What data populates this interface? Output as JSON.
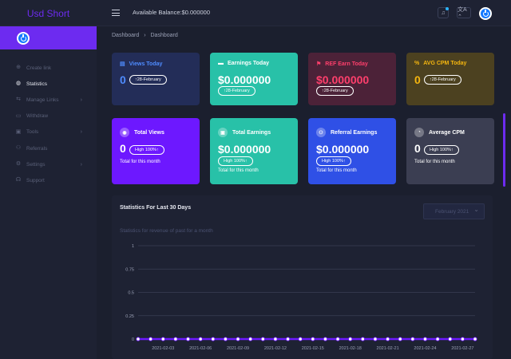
{
  "brand": {
    "name": "Usd Short"
  },
  "topbar": {
    "balance": "Available Balance:$0.000000",
    "bell_icon": "bell-icon",
    "lang_icon": "translate-icon",
    "lang_glyph": "文A ⌃"
  },
  "sidebar": {
    "items": [
      {
        "label": "Create link",
        "icon": "⊕",
        "active": false
      },
      {
        "label": "Statistics",
        "icon": "◍",
        "active": true
      },
      {
        "label": "Manage Links",
        "icon": "⇆",
        "active": false,
        "chevron": "›"
      },
      {
        "label": "Withdraw",
        "icon": "▭",
        "active": false
      },
      {
        "label": "Tools",
        "icon": "▣",
        "active": false,
        "chevron": "›"
      },
      {
        "label": "Referrals",
        "icon": "⚇",
        "active": false
      },
      {
        "label": "Settings",
        "icon": "⚙",
        "active": false,
        "chevron": "›"
      },
      {
        "label": "Support",
        "icon": "☊",
        "active": false
      }
    ]
  },
  "breadcrumb": {
    "root": "Dashboard",
    "separator": "›",
    "current": "Dashboard"
  },
  "cards_row1": [
    {
      "label": "Views Today",
      "value": "0",
      "badge": "↑28-February",
      "bg": "#232d58",
      "label_color": "#4f8cff",
      "symbol": "▤"
    },
    {
      "label": "Earnings Today",
      "value": "$0.000000",
      "badge": "↑28-February",
      "bg": "#28c1a8",
      "label_color": "#ffffff",
      "symbol": "▬"
    },
    {
      "label": "REF Earn Today",
      "value": "$0.000000",
      "badge": "↑28-February",
      "bg": "#4c2238",
      "label_color": "#ff3f6c",
      "value_color": "#ff3f6c",
      "symbol": "⚑"
    },
    {
      "label": "AVG CPM Today",
      "value": "0",
      "badge": "↑28-February",
      "bg": "#4c4120",
      "label_color": "#f5b60f",
      "value_color": "#f5b60f",
      "symbol": "%"
    }
  ],
  "cards_row2": [
    {
      "label": "Total Views",
      "value": "0",
      "badge": "High  100%↑",
      "sub": "Total for this month",
      "bg": "#6d18ff",
      "symbol": "◉"
    },
    {
      "label": "Total Earnings",
      "value": "$0.000000",
      "badge": "High  100%↑",
      "sub": "Total for this month",
      "bg": "#28c1a8",
      "symbol": "▣"
    },
    {
      "label": "Referral Earnings",
      "value": "$0.000000",
      "badge": "High  100%↑",
      "sub": "Total for this month",
      "bg": "#2f50e6",
      "symbol": "⚇"
    },
    {
      "label": "Average CPM",
      "value": "0",
      "badge": "High  100%↑",
      "sub": "Total for this month",
      "bg": "#3b3e52",
      "symbol": "◔"
    }
  ],
  "stats": {
    "title": "Statistics For Last 30 Days",
    "subtitle": "Statistics for revenue of past for a month",
    "select_value": "February 2021"
  },
  "chart_data": {
    "type": "line",
    "ylim": [
      0,
      1
    ],
    "yticks": [
      "1",
      "0.75",
      "0.5",
      "0.25",
      "0"
    ],
    "xtick_labels": [
      "2021-02-03",
      "2021-02-06",
      "2021-02-09",
      "2021-02-12",
      "2021-02-15",
      "2021-02-18",
      "2021-02-21",
      "2021-02-24",
      "2021-02-27"
    ],
    "series": [
      {
        "values": [
          0,
          0,
          0,
          0,
          0,
          0,
          0,
          0,
          0,
          0,
          0,
          0,
          0,
          0,
          0,
          0,
          0,
          0,
          0,
          0,
          0,
          0,
          0,
          0,
          0,
          0,
          0,
          0
        ],
        "color": "#6d18ff"
      }
    ],
    "grid": true
  }
}
